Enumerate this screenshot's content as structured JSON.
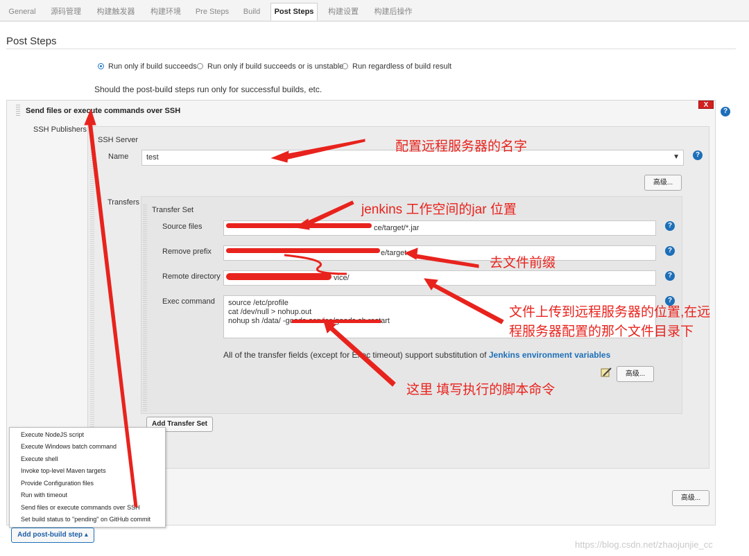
{
  "tabs": [
    {
      "label": "General"
    },
    {
      "label": "源码管理"
    },
    {
      "label": "构建触发器"
    },
    {
      "label": "构建环境"
    },
    {
      "label": "Pre Steps"
    },
    {
      "label": "Build"
    },
    {
      "label": "Post Steps",
      "active": true
    },
    {
      "label": "构建设置"
    },
    {
      "label": "构建后操作"
    }
  ],
  "section_title": "Post Steps",
  "radios": [
    {
      "label": "Run only if build succeeds",
      "selected": true
    },
    {
      "label": "Run only if build succeeds or is unstable",
      "selected": false
    },
    {
      "label": "Run regardless of build result",
      "selected": false
    }
  ],
  "radio_description": "Should the post-build steps run only for successful builds, etc.",
  "step": {
    "title": "Send files or execute commands over SSH",
    "delete_label": "X",
    "ssh_publishers_label": "SSH Publishers",
    "ssh_server_label": "SSH Server",
    "name_label": "Name",
    "name_value": "test",
    "advanced_label": "高级...",
    "transfers_label": "Transfers",
    "transfer_set_label": "Transfer Set",
    "source_files_label": "Source files",
    "source_files_value": "ce/target/*.jar",
    "remove_prefix_label": "Remove prefix",
    "remove_prefix_value": "e/target",
    "remote_directory_label": "Remote directory",
    "remote_directory_value": "vice/",
    "exec_command_label": "Exec command",
    "exec_command_lines": [
      "source /etc/profile",
      "cat /dev/null > nohup.out",
      "nohup sh  /data/                    -goods-service/goods.sh  restart"
    ],
    "substitution_note": "All of the transfer fields (except for Exec timeout) support substitution of",
    "substitution_link": "Jenkins environment variables",
    "add_transfer_set_label": "Add Transfer Set",
    "outer_advanced_label": "高级..."
  },
  "menu": {
    "items": [
      "Execute NodeJS script",
      "Execute Windows batch command",
      "Execute shell",
      "Invoke top-level Maven targets",
      "Provide Configuration files",
      "Run with timeout",
      "Send files or execute commands over SSH",
      "Set build status to \"pending\" on GitHub commit"
    ],
    "button_label": "Add post-build step"
  },
  "annotations": {
    "a1": "配置远程服务器的名字",
    "a2": "jenkins 工作空间的jar 位置",
    "a3": "去文件前缀",
    "a4_line1": "文件上传到远程服务器的位置,在远",
    "a4_line2": "程服务器配置的那个文件目录下",
    "a5": "这里 填写执行的脚本命令"
  },
  "watermark": "https://blog.csdn.net/zhaojunjie_cc",
  "colors": {
    "annotation": "#e8231d",
    "link": "#1d6fb8",
    "help": "#1d6fb8"
  }
}
